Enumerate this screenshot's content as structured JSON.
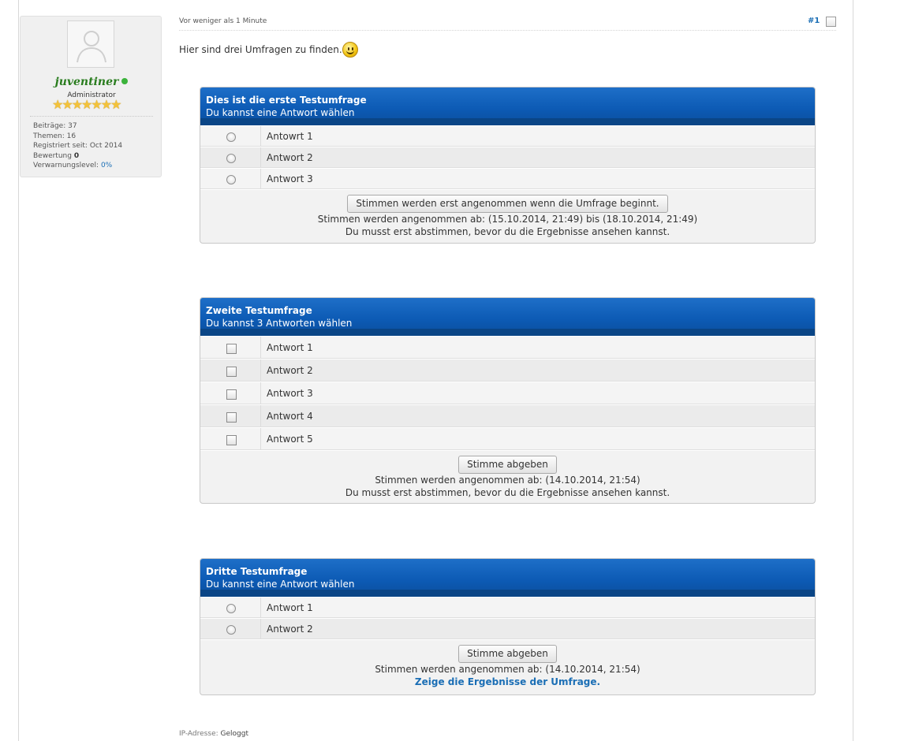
{
  "profile": {
    "username": "juventiner",
    "rank": "Administrator",
    "star_count": 7,
    "stats": [
      {
        "label": "Beiträge:",
        "value": "37",
        "style": "plain"
      },
      {
        "label": "Themen:",
        "value": "16",
        "style": "plain"
      },
      {
        "label": "Registriert seit:",
        "value": "Oct 2014",
        "style": "plain"
      },
      {
        "label": "Bewertung",
        "value": "0",
        "style": "strong"
      },
      {
        "label": "Verwarnungslevel:",
        "value": "0%",
        "style": "link"
      }
    ]
  },
  "post": {
    "time": "Vor weniger als 1 Minute",
    "number": "#1",
    "intro": "Hier sind drei Umfragen zu finden...",
    "ip_label": "IP-Adresse:",
    "ip_value": "Geloggt"
  },
  "polls": [
    {
      "title": "Dies ist die erste Testumfrage",
      "subtitle": "Du kannst eine Antwort wählen",
      "type": "radio",
      "options": [
        "Antowrt 1",
        "Antwort 2",
        "Antwort 3"
      ],
      "button": "Stimmen werden erst angenommen wenn die Umfrage beginnt.",
      "info": "Stimmen werden angenommen ab: (15.10.2014, 21:49) bis (18.10.2014, 21:49)",
      "note": "Du musst erst abstimmen, bevor du die Ergebnisse ansehen kannst.",
      "note_is_link": false
    },
    {
      "title": "Zweite Testumfrage",
      "subtitle": "Du kannst 3 Antworten wählen",
      "type": "checkbox",
      "options": [
        "Antwort 1",
        "Antwort 2",
        "Antwort 3",
        "Antwort 4",
        "Antwort 5"
      ],
      "button": "Stimme abgeben",
      "info": "Stimmen werden angenommen ab: (14.10.2014, 21:54)",
      "note": "Du musst erst abstimmen, bevor du die Ergebnisse ansehen kannst.",
      "note_is_link": false
    },
    {
      "title": "Dritte Testumfrage",
      "subtitle": "Du kannst eine Antwort wählen",
      "type": "radio",
      "options": [
        "Antwort 1",
        "Antwort 2"
      ],
      "button": "Stimme abgeben",
      "info": "Stimmen werden angenommen ab: (14.10.2014, 21:54)",
      "note": "Zeige die Ergebnisse der Umfrage.",
      "note_is_link": true
    }
  ],
  "colors": {
    "header_blue": "#0d5bb5",
    "link_blue": "#1a6eb5",
    "username_green": "#2a7d1f"
  }
}
